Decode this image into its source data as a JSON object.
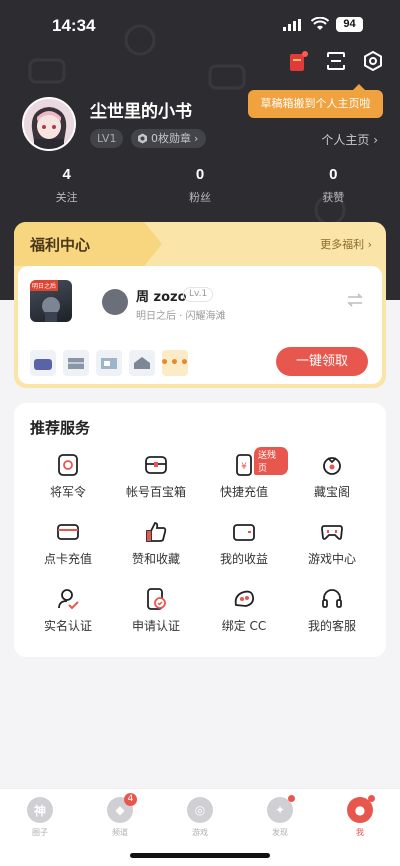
{
  "status": {
    "time": "14:34",
    "battery": "94"
  },
  "tip": "草稿箱搬到个人主页啦",
  "profile": {
    "name": "尘世里的小书",
    "level": "LV1",
    "badge": "0枚勋章",
    "homepage_link": "个人主页"
  },
  "stats": [
    {
      "value": "4",
      "label": "关注"
    },
    {
      "value": "0",
      "label": "粉丝"
    },
    {
      "value": "0",
      "label": "获赞"
    }
  ],
  "welfare": {
    "title": "福利中心",
    "more": "更多福利",
    "game_tag": "明日之后",
    "user_name": "周 zozo",
    "user_level": "Lv.1",
    "user_sub": "明日之后 · 闪耀海滩",
    "more_items": "•••",
    "claim_button": "一键领取"
  },
  "services": {
    "title": "推荐服务",
    "items": [
      {
        "label": "将军令",
        "icon": "token-icon"
      },
      {
        "label": "帐号百宝箱",
        "icon": "treasure-box-icon"
      },
      {
        "label": "快捷充值",
        "icon": "phone-recharge-icon",
        "tag": "送残页"
      },
      {
        "label": "藏宝阁",
        "icon": "treasure-pavilion-icon"
      },
      {
        "label": "点卡充值",
        "icon": "card-icon"
      },
      {
        "label": "赞和收藏",
        "icon": "thumbs-up-icon"
      },
      {
        "label": "我的收益",
        "icon": "wallet-icon"
      },
      {
        "label": "游戏中心",
        "icon": "gamepad-icon"
      },
      {
        "label": "实名认证",
        "icon": "user-verify-icon"
      },
      {
        "label": "申请认证",
        "icon": "apply-verify-icon"
      },
      {
        "label": "绑定 CC",
        "icon": "bind-cc-icon"
      },
      {
        "label": "我的客服",
        "icon": "headset-icon"
      }
    ]
  },
  "tabbar": [
    {
      "label": "圈子",
      "glyph": "神"
    },
    {
      "label": "频道",
      "glyph": "◆",
      "count": "4"
    },
    {
      "label": "游戏",
      "glyph": "◎"
    },
    {
      "label": "发现",
      "glyph": "✦"
    },
    {
      "label": "我",
      "glyph": "●"
    }
  ]
}
